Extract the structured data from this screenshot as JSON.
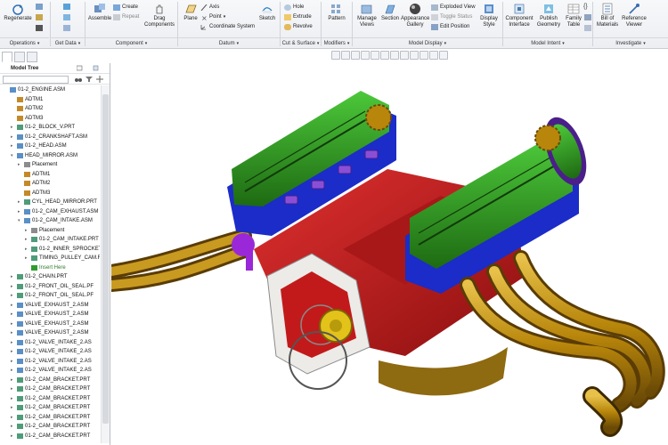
{
  "ribbon": {
    "regenerate": "Regenerate",
    "groups": {
      "operations": "Operations",
      "get_data": "Get Data",
      "component": "Component",
      "datum": "Datum",
      "cut_surface": "Cut & Surface",
      "modifiers": "Modifiers",
      "model_display": "Model Display",
      "model_intent": "Model Intent",
      "investigate": "Investigate"
    },
    "assemble": "Assemble",
    "create": "Create",
    "repeat": "Repeat",
    "drag_components": "Drag Components",
    "plane": "Plane",
    "axis": "Axis",
    "point": "Point",
    "coordinate_system": "Coordinate System",
    "sketch": "Sketch",
    "hole": "Hole",
    "extrude": "Extrude",
    "revolve": "Revolve",
    "pattern": "Pattern",
    "manage_views": "Manage Views",
    "section": "Section",
    "appearance_gallery": "Appearance Gallery",
    "exploded_view": "Exploded View",
    "toggle_status": "Toggle Status",
    "edit_position": "Edit Position",
    "display_style": "Display Style",
    "component_interface": "Component Interface",
    "publish_geometry": "Publish Geometry",
    "family_table": "Family Table",
    "bill_of_materials": "Bill of Materials",
    "reference_viewer": "Reference Viewer"
  },
  "panel": {
    "title": "Model Tree",
    "search_placeholder": ""
  },
  "tree": [
    {
      "label": "01-2_ENGINE.ASM",
      "indent": 0,
      "icon": "asm",
      "expand": ""
    },
    {
      "label": "ADTM1",
      "indent": 1,
      "icon": "datum",
      "expand": ""
    },
    {
      "label": "ADTM2",
      "indent": 1,
      "icon": "datum",
      "expand": ""
    },
    {
      "label": "ADTM3",
      "indent": 1,
      "icon": "datum",
      "expand": ""
    },
    {
      "label": "01-2_BLOCK_V.PRT",
      "indent": 1,
      "icon": "prt",
      "expand": "▸"
    },
    {
      "label": "01-2_CRANKSHAFT.ASM",
      "indent": 1,
      "icon": "asm",
      "expand": "▸"
    },
    {
      "label": "01-2_HEAD.ASM",
      "indent": 1,
      "icon": "asm",
      "expand": "▸"
    },
    {
      "label": "HEAD_MIRROR.ASM",
      "indent": 1,
      "icon": "asm",
      "expand": "▾"
    },
    {
      "label": "Placement",
      "indent": 2,
      "icon": "place",
      "expand": "▸"
    },
    {
      "label": "ADTM1",
      "indent": 2,
      "icon": "datum",
      "expand": ""
    },
    {
      "label": "ADTM2",
      "indent": 2,
      "icon": "datum",
      "expand": ""
    },
    {
      "label": "ADTM3",
      "indent": 2,
      "icon": "datum",
      "expand": ""
    },
    {
      "label": "CYL_HEAD_MIRROR.PRT",
      "indent": 2,
      "icon": "prt",
      "expand": "▸"
    },
    {
      "label": "01-2_CAM_EXHAUST.ASM",
      "indent": 2,
      "icon": "asm",
      "expand": "▸"
    },
    {
      "label": "01-2_CAM_INTAKE.ASM",
      "indent": 2,
      "icon": "asm",
      "expand": "▾"
    },
    {
      "label": "Placement",
      "indent": 3,
      "icon": "place",
      "expand": "▸"
    },
    {
      "label": "01-2_CAM_INTAKE.PRT",
      "indent": 3,
      "icon": "prt",
      "expand": "▸"
    },
    {
      "label": "01-2_INNER_SPROCKET",
      "indent": 3,
      "icon": "prt",
      "expand": "▸"
    },
    {
      "label": "TIMING_PULLEY_CAM.F",
      "indent": 3,
      "icon": "prt",
      "expand": "▸"
    },
    {
      "label": "Insert Here",
      "indent": 3,
      "icon": "insert",
      "expand": ""
    },
    {
      "label": "01-2_CHAIN.PRT",
      "indent": 1,
      "icon": "prt",
      "expand": "▸"
    },
    {
      "label": "01-2_FRONT_OIL_SEAL.PF",
      "indent": 1,
      "icon": "prt",
      "expand": "▸"
    },
    {
      "label": "01-2_FRONT_OIL_SEAL.PF",
      "indent": 1,
      "icon": "prt",
      "expand": "▸"
    },
    {
      "label": "VALVE_EXHAUST_2.ASM",
      "indent": 1,
      "icon": "asm",
      "expand": "▸"
    },
    {
      "label": "VALVE_EXHAUST_2.ASM",
      "indent": 1,
      "icon": "asm",
      "expand": "▸"
    },
    {
      "label": "VALVE_EXHAUST_2.ASM",
      "indent": 1,
      "icon": "asm",
      "expand": "▸"
    },
    {
      "label": "VALVE_EXHAUST_2.ASM",
      "indent": 1,
      "icon": "asm",
      "expand": "▸"
    },
    {
      "label": "01-2_VALVE_INTAKE_2.AS",
      "indent": 1,
      "icon": "asm",
      "expand": "▸"
    },
    {
      "label": "01-2_VALVE_INTAKE_2.AS",
      "indent": 1,
      "icon": "asm",
      "expand": "▸"
    },
    {
      "label": "01-2_VALVE_INTAKE_2.AS",
      "indent": 1,
      "icon": "asm",
      "expand": "▸"
    },
    {
      "label": "01-2_VALVE_INTAKE_2.AS",
      "indent": 1,
      "icon": "asm",
      "expand": "▸"
    },
    {
      "label": "01-2_CAM_BRACKET.PRT",
      "indent": 1,
      "icon": "prt",
      "expand": "▸"
    },
    {
      "label": "01-2_CAM_BRACKET.PRT",
      "indent": 1,
      "icon": "prt",
      "expand": "▸"
    },
    {
      "label": "01-2_CAM_BRACKET.PRT",
      "indent": 1,
      "icon": "prt",
      "expand": "▸"
    },
    {
      "label": "01-2_CAM_BRACKET.PRT",
      "indent": 1,
      "icon": "prt",
      "expand": "▸"
    },
    {
      "label": "01-2_CAM_BRACKET.PRT",
      "indent": 1,
      "icon": "prt",
      "expand": "▸"
    },
    {
      "label": "01-2_CAM_BRACKET.PRT",
      "indent": 1,
      "icon": "prt",
      "expand": "▸"
    },
    {
      "label": "01-2_CAM_BRACKET.PRT",
      "indent": 1,
      "icon": "prt",
      "expand": "▸"
    }
  ],
  "icons": {
    "asm": "#5a8fc7",
    "prt": "#4f9c7a",
    "datum": "#c48a2a",
    "place": "#8c8c8c",
    "insert": "#2e9d2e"
  },
  "colors": {
    "block_red": "#c21a1a",
    "head_blue": "#1a2fd0",
    "cover_green": "#2f9a1c",
    "pipes_gold": "#b8860b",
    "cap_purple": "#9a28d8",
    "timing_purple": "#4a1f8a",
    "frame_white": "#ecebe8"
  }
}
